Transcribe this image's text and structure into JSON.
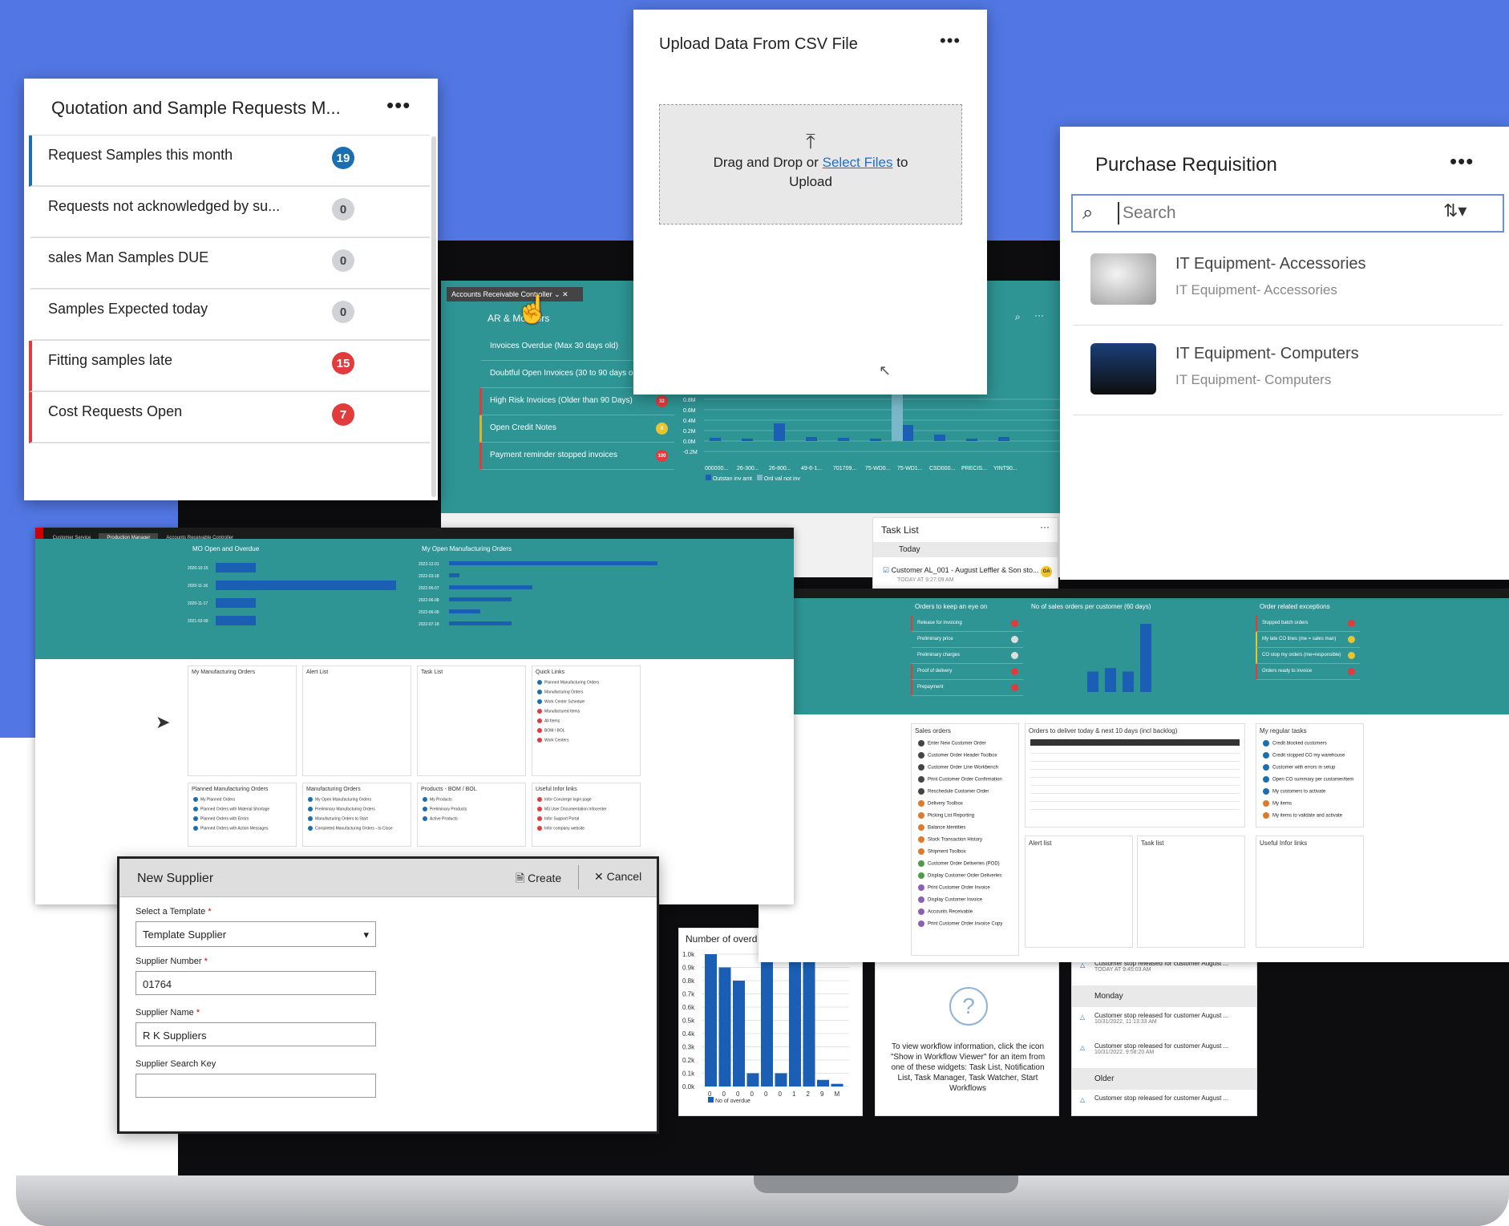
{
  "quotation": {
    "title": "Quotation and Sample Requests M...",
    "items": [
      {
        "label": "Request Samples this month",
        "count": "19",
        "color": "#1a6fb0"
      },
      {
        "label": "Requests not acknowledged by su...",
        "count": "0",
        "color": "#cfd2d6"
      },
      {
        "label": "sales Man Samples DUE",
        "count": "0",
        "color": "#cfd2d6"
      },
      {
        "label": "Samples Expected today",
        "count": "0",
        "color": "#cfd2d6"
      },
      {
        "label": "Fitting samples late",
        "count": "15",
        "color": "#e23b3b"
      },
      {
        "label": "Cost Requests Open",
        "count": "7",
        "color": "#e23b3b"
      }
    ]
  },
  "upload": {
    "title": "Upload Data From CSV File",
    "drag_text": "Drag and Drop or",
    "select_link": "Select Files",
    "to_text": "to",
    "upload_text": "Upload"
  },
  "purchase": {
    "title": "Purchase Requisition",
    "search_placeholder": "Search",
    "items": [
      {
        "title": "IT Equipment- Accessories",
        "subtitle": "IT Equipment- Accessories",
        "icon": "mouse-icon"
      },
      {
        "title": "IT Equipment- Computers",
        "subtitle": "IT Equipment- Computers",
        "icon": "laptop-icon"
      }
    ]
  },
  "ar": {
    "tab": "Accounts Receivable Controller",
    "monitors_title": "AR & Monitors",
    "items": [
      {
        "label": "Invoices Overdue (Max 30 days old)",
        "badge": ""
      },
      {
        "label": "Doubtful Open Invoices (30 to 90 days old)",
        "badge": ""
      },
      {
        "label": "High Risk Invoices (Older than 90 Days)",
        "badge": "32"
      },
      {
        "label": "Open Credit Notes",
        "badge": "0"
      },
      {
        "label": "Payment reminder stopped invoices",
        "badge": "100"
      }
    ],
    "yticks": [
      "0.8M",
      "0.6M",
      "0.4M",
      "0.2M",
      "0.0M",
      "-0.2M"
    ],
    "xticks": [
      "000000...",
      "26-300...",
      "26-800...",
      "49-6-1...",
      "701709...",
      "75-WD0...",
      "75-WD1...",
      "CSD000...",
      "PRECIS...",
      "YINT90..."
    ],
    "legend1": "Outstan inv amt",
    "legend2": "Ord val not inv"
  },
  "task_list": {
    "title": "Task List",
    "group": "Today",
    "item": "Customer AL_001 - August Leffler & Son sto...",
    "time": "TODAY AT 9:27:09 AM",
    "avatar": "GA"
  },
  "production": {
    "tabs": [
      "Customer Service",
      "Production Manager",
      "Accounts Receivable Controller"
    ],
    "chart1_title": "MO Open and Overdue",
    "chart2_title": "My Open Manufacturing Orders",
    "chart1_dates": [
      "2020-10-15",
      "2020-11-16",
      "2020-11-17",
      "2021-02-09"
    ],
    "chart2_dates": [
      "2022-12-01",
      "2022-03-18",
      "2022-06-07",
      "2022-06-08",
      "2022-06-09",
      "2022-07-18"
    ],
    "widgets": [
      "My Manufacturing Orders",
      "Alert List",
      "Task List",
      "Quick Links",
      "Planned Manufacturing Orders",
      "Manufacturing Orders",
      "Products - BOM / BOL",
      "Useful Infor links"
    ],
    "quick_links": [
      "Planned Manufacturing Orders",
      "Manufacturing Orders",
      "Work Center Schedule",
      "Manufactured Items",
      "All Items",
      "BOM / BOL",
      "Work Centers"
    ],
    "planned": [
      "My Planned Orders",
      "Planned Orders with Material Shortage",
      "Planned Orders with Errors",
      "Planned Orders with Action Messages"
    ],
    "mos": [
      "My Open Manufacturing Orders",
      "Preliminary Manufacturing Orders",
      "Manufacturing Orders to Start",
      "Completed Manufacturing Orders - to Close"
    ],
    "products": [
      "My Products",
      "Preliminary Products",
      "Active Products"
    ],
    "infor": [
      "Infor Concierge login page",
      "M3 User Documentation Infocenter",
      "Infor Support Portal",
      "Infor company website"
    ]
  },
  "customer": {
    "w1": "Orders to keep an eye on",
    "w2": "No of sales orders per customer (60 days)",
    "w3": "Order related exceptions",
    "w1_items": [
      "Release for invoicing",
      "Preliminary price",
      "Preliminary charges",
      "Proof of delivery",
      "Prepayment"
    ],
    "w3_items": [
      "Stopped batch orders",
      "My late CO lines (me = sales man)",
      "CO stop my orders (me=responsible)",
      "Orders ready to invoice"
    ],
    "w4": "Sales orders",
    "w5": "Orders to deliver today & next 10 days (incl backlog)",
    "w6": "My regular tasks",
    "w7": "Alert list",
    "w8": "Task list",
    "w9": "Useful Infor links",
    "sales_items": [
      "Enter New Customer Order",
      "Customer Order Header Toolbox",
      "Customer Order Line Workbench",
      "Print Customer Order Confirmation",
      "Reschedule Customer Order",
      "Delivery Toolbox",
      "Picking List Reporting",
      "Balance Identities",
      "Stock Transaction History",
      "Shipment Toolbox",
      "Customer Order Deliveries (POD)",
      "Display Customer Order Deliveries",
      "Print Customer Order Invoice",
      "Display Customer Invoice",
      "Accounts Receivable",
      "Print Customer Order Invoice Copy"
    ],
    "tasks": [
      "Credit blocked customers",
      "Credit stopped CO my warehouse",
      "Customer with errors in setup",
      "Open CO summary per customer/item",
      "My customers to activate",
      "My items",
      "My items to validate and activate"
    ]
  },
  "overdue": {
    "title": "Number of overd",
    "yticks": [
      "1.0k",
      "0.9k",
      "0.8k",
      "0.7k",
      "0.6k",
      "0.5k",
      "0.4k",
      "0.3k",
      "0.2k",
      "0.1k",
      "0.0k"
    ],
    "xticks": [
      "0",
      "0",
      "0",
      "0",
      "0",
      "0",
      "1",
      "2",
      "9",
      "M"
    ],
    "legend": "No of overdue"
  },
  "workflow": {
    "text": "To view workflow information, click the icon \"Show in Workflow Viewer\" for an item from one of these widgets: Task List, Notification List, Task Manager, Task Watcher, Start Workflows"
  },
  "alerts": {
    "items": [
      {
        "text": "Customer stop released for customer August ...",
        "time": "TODAY AT 9:45:03 AM"
      },
      {
        "text": "Customer stop released for customer August ...",
        "time": "10/31/2022, 11:13:33 AM"
      },
      {
        "text": "Customer stop released for customer August ...",
        "time": "10/31/2022, 9:58:20 AM"
      },
      {
        "text": "Customer stop released for customer August ...",
        "time": ""
      }
    ],
    "g_monday": "Monday",
    "g_older": "Older"
  },
  "supplier": {
    "title": "New Supplier",
    "create": "Create",
    "cancel": "Cancel",
    "template_label": "Select a Template",
    "template_value": "Template Supplier",
    "number_label": "Supplier Number",
    "number_value": "01764",
    "name_label": "Supplier Name",
    "name_value": "R K Suppliers",
    "key_label": "Supplier Search Key",
    "key_value": ""
  }
}
